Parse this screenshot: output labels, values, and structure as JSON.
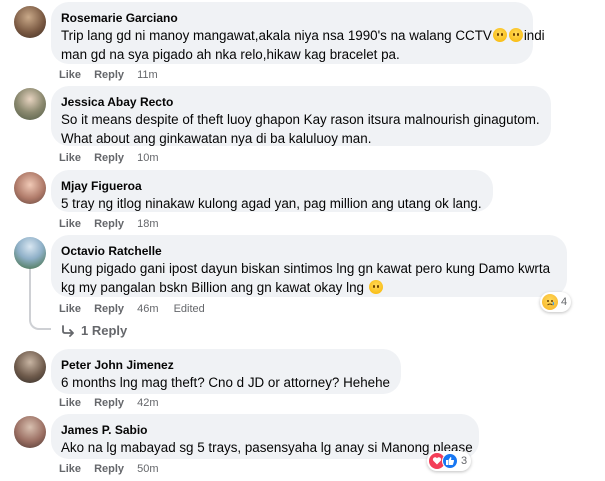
{
  "comments": [
    {
      "name": "Rosemarie Garciano",
      "lines": [
        "Trip lang gd ni manoy mangawat,akala niya nsa 1990's na walang CCTV",
        "indi",
        "man gd na sya pigado ah nka relo,hikaw kag bracelet pa."
      ],
      "like": "Like",
      "reply": "Reply",
      "time": "11m"
    },
    {
      "name": "Jessica Abay Recto",
      "lines": [
        "So it means despite of theft luoy ghapon Kay rason itsura malnourish ginagutom.",
        "What about ang ginkawatan nya di ba kaluluoy man."
      ],
      "like": "Like",
      "reply": "Reply",
      "time": "10m"
    },
    {
      "name": "Mjay Figueroa",
      "lines": [
        "5 tray ng itlog ninakaw kulong agad yan, pag million ang utang ok lang."
      ],
      "like": "Like",
      "reply": "Reply",
      "time": "18m"
    },
    {
      "name": "Octavio Ratchelle",
      "lines": [
        "Kung pigado gani ipost dayun biskan sintimos lng gn kawat pero kung Damo kwrta",
        "kg my pangalan bskn Billion ang gn kawat okay lng"
      ],
      "like": "Like",
      "reply": "Reply",
      "time": "46m",
      "edited": "Edited",
      "reaction_count": "4",
      "reply_toggle": "1 Reply"
    },
    {
      "name": "Peter John Jimenez",
      "lines": [
        "6 months lng mag theft? Cno d JD or attorney? Hehehe"
      ],
      "like": "Like",
      "reply": "Reply",
      "time": "42m"
    },
    {
      "name": "James P. Sabio",
      "lines": [
        "Ako na lg mabayad sg 5 trays, pasensyaha lg anay si Manong please"
      ],
      "like": "Like",
      "reply": "Reply",
      "time": "50m",
      "reaction_count": "3"
    }
  ],
  "colors": {
    "bubble": "#f0f2f5",
    "meta_text": "#65676b",
    "love": "#f33e58",
    "like_blue": "#1877f2",
    "sad_yellow": "#f7b125"
  }
}
